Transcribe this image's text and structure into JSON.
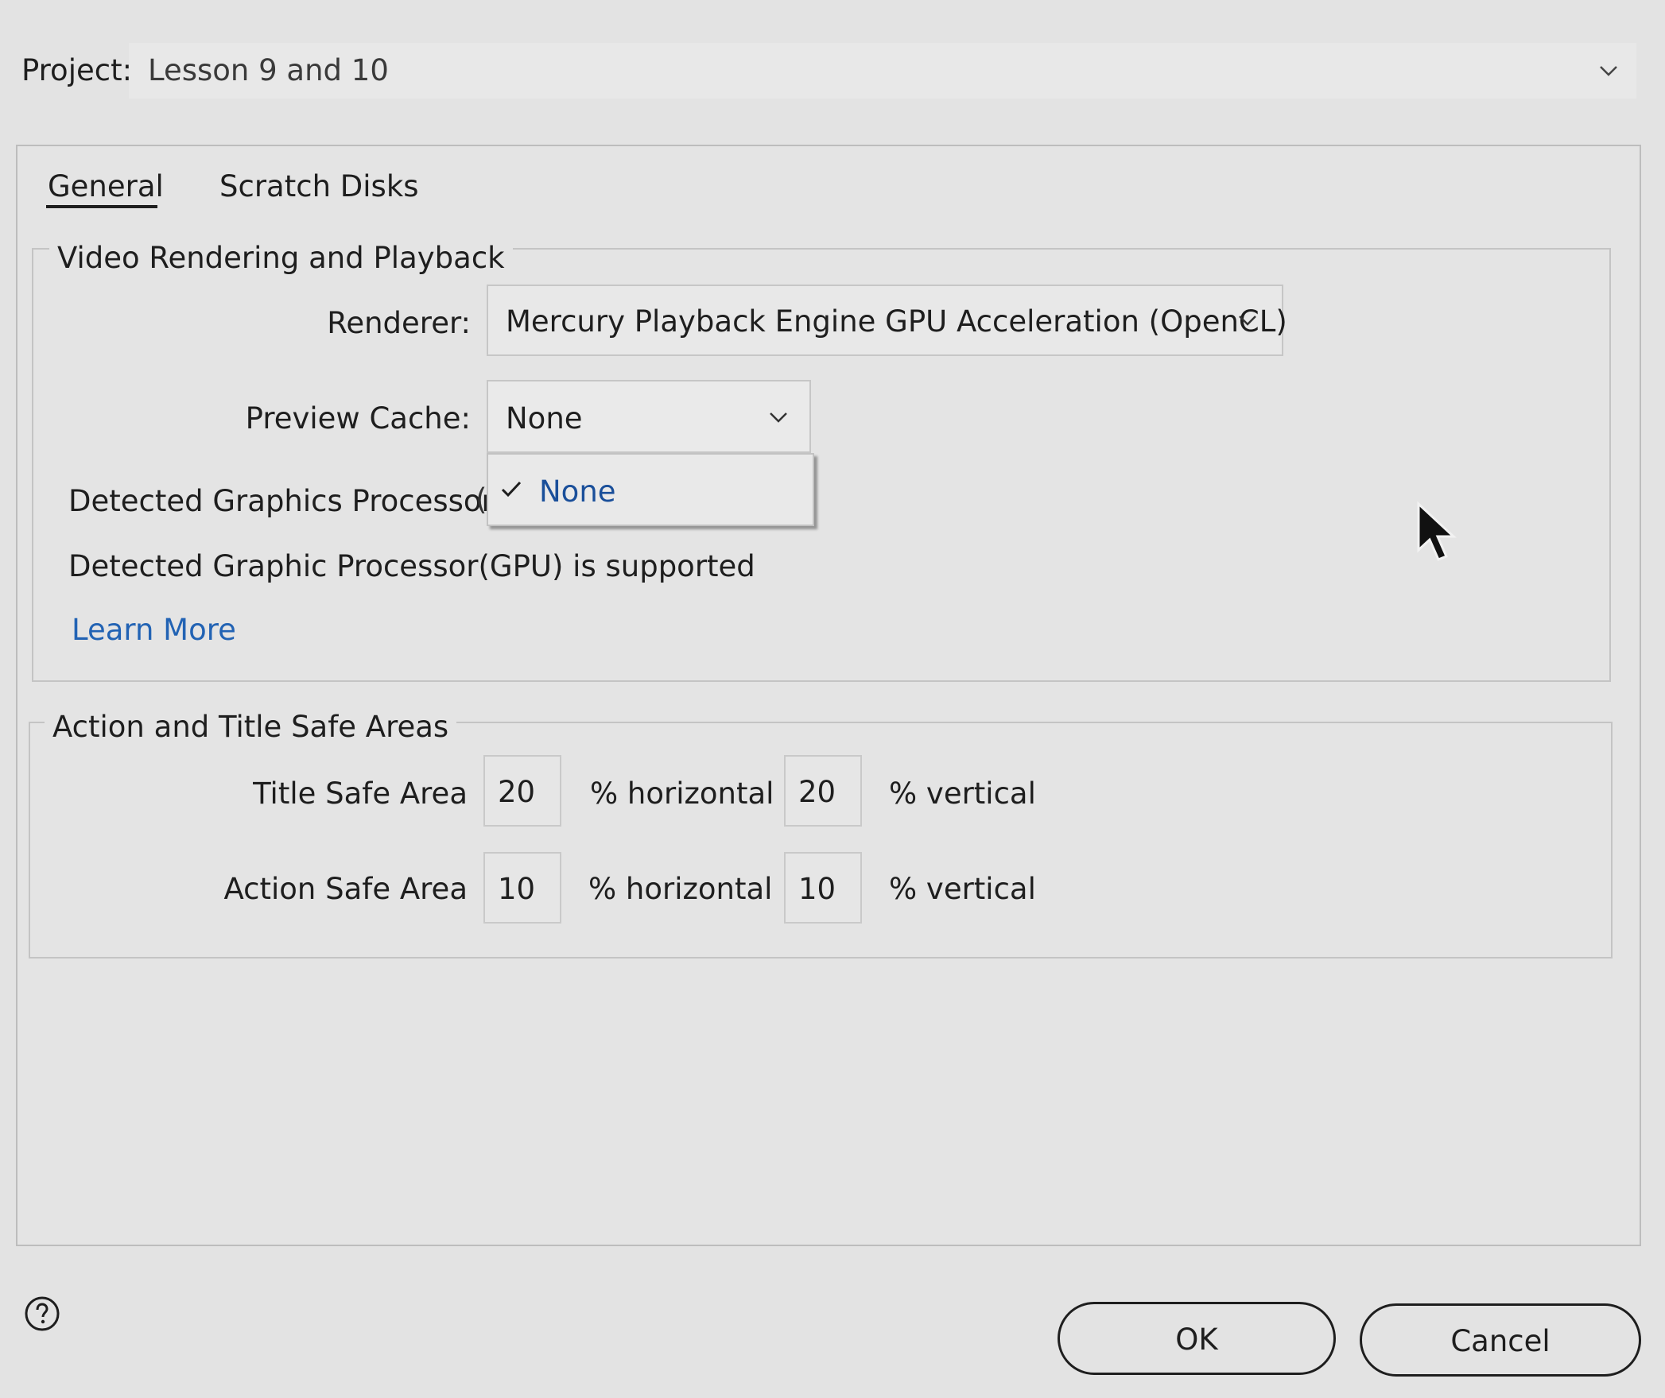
{
  "project": {
    "label": "Project:",
    "value": "Lesson 9 and 10"
  },
  "tabs": [
    {
      "label": "General",
      "active": true
    },
    {
      "label": "Scratch Disks",
      "active": false
    }
  ],
  "video_rendering": {
    "title": "Video Rendering and Playback",
    "renderer_label": "Renderer:",
    "renderer_value": "Mercury Playback Engine GPU Acceleration (OpenCL)",
    "preview_cache_label": "Preview Cache:",
    "preview_cache_value": "None",
    "preview_cache_options": [
      {
        "label": "None",
        "selected": true
      }
    ],
    "gpu_label": "Detected Graphics Processor:",
    "gpu_value_partial": "(",
    "gpu_supported_text": "Detected Graphic Processor(GPU) is supported",
    "learn_more": "Learn More"
  },
  "safe_areas": {
    "title": "Action and Title Safe Areas",
    "title_safe": {
      "label": "Title Safe Area",
      "horizontal": "20",
      "horizontal_suffix": "% horizontal",
      "vertical": "20",
      "vertical_suffix": "% vertical"
    },
    "action_safe": {
      "label": "Action Safe Area",
      "horizontal": "10",
      "horizontal_suffix": "% horizontal",
      "vertical": "10",
      "vertical_suffix": "% vertical"
    }
  },
  "footer": {
    "ok_label": "OK",
    "cancel_label": "Cancel",
    "help_icon": "question-circle-icon"
  },
  "colors": {
    "link": "#2263b4",
    "selected_option": "#1a4f9a",
    "background": "#e3e3e3"
  }
}
